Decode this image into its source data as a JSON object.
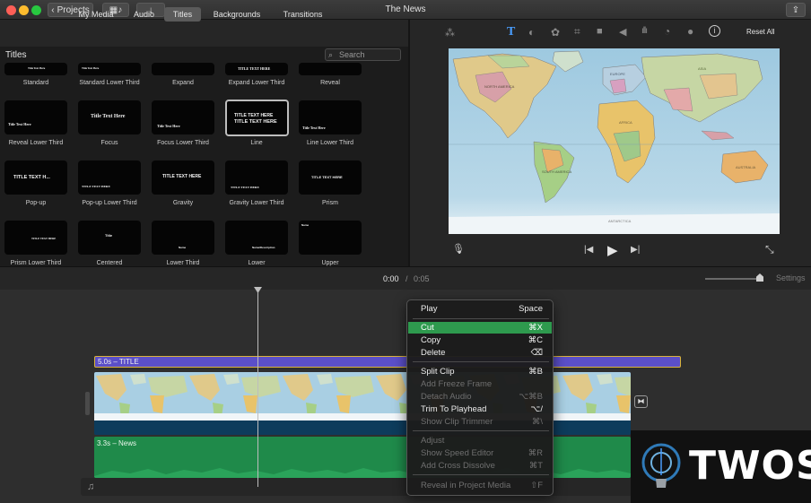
{
  "window": {
    "title": "The News",
    "projects_button": "Projects",
    "traffic_light_colors": [
      "#ff5f57",
      "#febc2e",
      "#28c840"
    ]
  },
  "browser_tabs": [
    {
      "label": "My Media",
      "active": false
    },
    {
      "label": "Audio",
      "active": false
    },
    {
      "label": "Titles",
      "active": true
    },
    {
      "label": "Backgrounds",
      "active": false
    },
    {
      "label": "Transitions",
      "active": false
    }
  ],
  "browser": {
    "heading": "Titles",
    "search_placeholder": "Search",
    "items": [
      {
        "label": "Standard",
        "preview": "Title Text Here"
      },
      {
        "label": "Standard Lower Third",
        "preview": "Title Text Here"
      },
      {
        "label": "Expand",
        "preview": ""
      },
      {
        "label": "Expand Lower Third",
        "preview": "TITLE TEXT HERE"
      },
      {
        "label": "Reveal",
        "preview": ""
      },
      {
        "label": "Reveal Lower Third",
        "preview": "Title Text Here"
      },
      {
        "label": "Focus",
        "preview": "Title Text Here"
      },
      {
        "label": "Focus Lower Third",
        "preview": "Title Text Here"
      },
      {
        "label": "Line",
        "preview": "TITLE TEXT HERE",
        "selected": true
      },
      {
        "label": "Line Lower Third",
        "preview": "Title Text Here"
      },
      {
        "label": "Pop-up",
        "preview": "TITLE TEXT H..."
      },
      {
        "label": "Pop-up Lower Third",
        "preview": "TITLE TEXT HERE"
      },
      {
        "label": "Gravity",
        "preview": "TITLE TEXT HERE"
      },
      {
        "label": "Gravity Lower Third",
        "preview": "TITLE TEXT HERE"
      },
      {
        "label": "Prism",
        "preview": "TITLE TEXT HERE"
      },
      {
        "label": "Prism Lower Third",
        "preview": "TITLE TEXT HERE"
      },
      {
        "label": "Centered",
        "preview": "Title"
      },
      {
        "label": "Lower Third",
        "preview": "Name"
      },
      {
        "label": "Lower",
        "preview": "Name/Description"
      },
      {
        "label": "Upper",
        "preview": "Name"
      }
    ]
  },
  "viewer": {
    "reset_all": "Reset All",
    "toolbar_icons": [
      "magic-wand-icon",
      "text-icon",
      "color-balance-icon",
      "color-correction-icon",
      "crop-icon",
      "stabilization-icon",
      "volume-icon",
      "equalizer-icon",
      "speed-icon",
      "filter-icon",
      "info-icon"
    ],
    "map_labels": [
      "ANTARCTICA",
      "AUSTRALIA",
      "AFRICA",
      "ASIA",
      "EUROPE",
      "NORTH AMERICA",
      "SOUTH AMERICA"
    ]
  },
  "timecode": {
    "current": "0:00",
    "separator": "/",
    "total": "0:05",
    "settings": "Settings"
  },
  "timeline": {
    "title_clip": "5.0s – TITLE",
    "audio_clip": "3.3s – News"
  },
  "context_menu": [
    {
      "label": "Play",
      "shortcut": "Space",
      "enabled": true
    },
    {
      "separator": true
    },
    {
      "label": "Cut",
      "shortcut": "⌘X",
      "enabled": true,
      "highlighted": true
    },
    {
      "label": "Copy",
      "shortcut": "⌘C",
      "enabled": true
    },
    {
      "label": "Delete",
      "shortcut": "⌫",
      "enabled": true
    },
    {
      "separator": true
    },
    {
      "label": "Split Clip",
      "shortcut": "⌘B",
      "enabled": true
    },
    {
      "label": "Add Freeze Frame",
      "shortcut": "",
      "enabled": false
    },
    {
      "label": "Detach Audio",
      "shortcut": "⌥⌘B",
      "enabled": false
    },
    {
      "label": "Trim To Playhead",
      "shortcut": "⌥/",
      "enabled": true
    },
    {
      "label": "Show Clip Trimmer",
      "shortcut": "⌘\\",
      "enabled": false
    },
    {
      "separator": true
    },
    {
      "label": "Adjust",
      "shortcut": "",
      "enabled": false
    },
    {
      "label": "Show Speed Editor",
      "shortcut": "⌘R",
      "enabled": false
    },
    {
      "label": "Add Cross Dissolve",
      "shortcut": "⌘T",
      "enabled": false
    },
    {
      "separator": true
    },
    {
      "label": "Reveal in Project Media",
      "shortcut": "⇧F",
      "enabled": false
    }
  ],
  "watermark": "TWOS",
  "accent_colors": {
    "menu_highlight": "#2e9a4e",
    "title_clip": "#5b4fc8",
    "audio_clip": "#1f8a4a",
    "text_tool": "#4a9eff"
  }
}
